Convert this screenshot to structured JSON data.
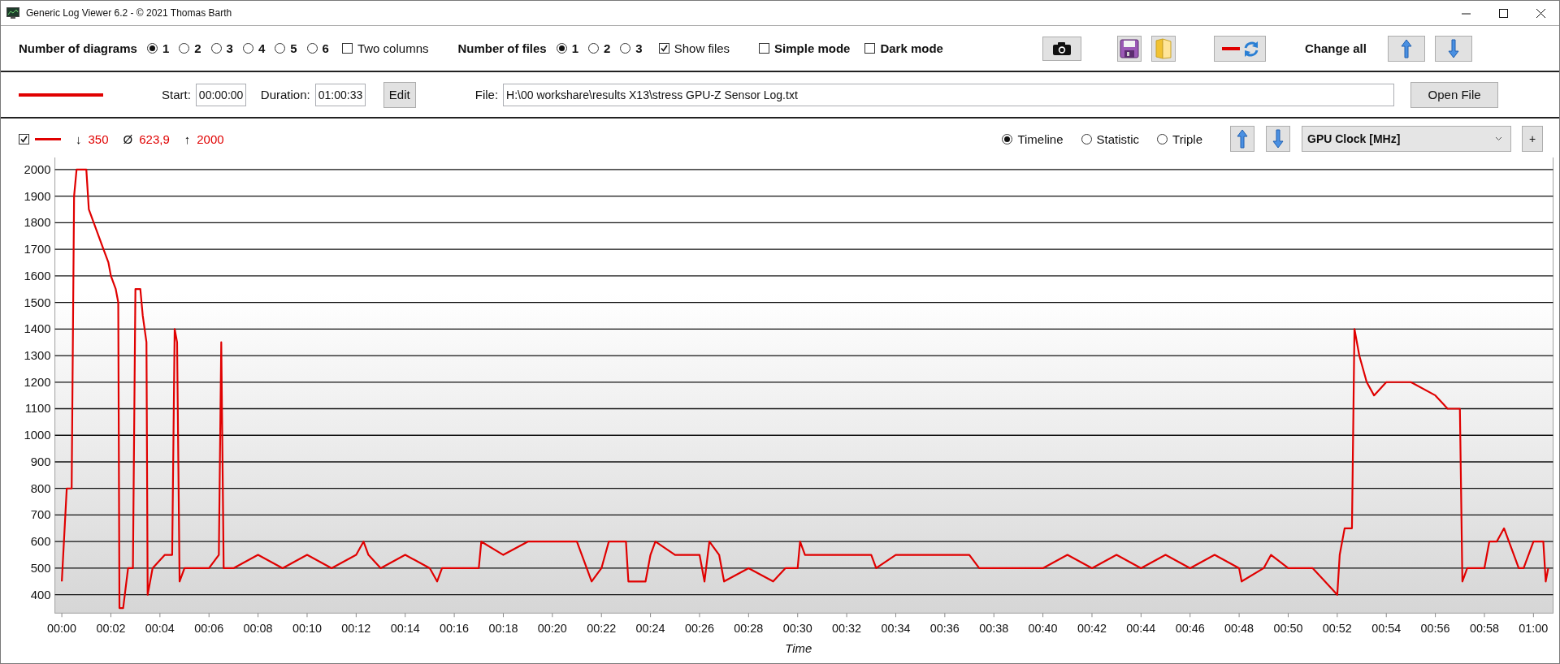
{
  "window": {
    "title": "Generic Log Viewer 6.2 - © 2021 Thomas Barth"
  },
  "toolbar": {
    "diagrams": {
      "label": "Number of diagrams",
      "options": [
        {
          "label": "1",
          "selected": true
        },
        {
          "label": "2",
          "selected": false
        },
        {
          "label": "3",
          "selected": false
        },
        {
          "label": "4",
          "selected": false
        },
        {
          "label": "5",
          "selected": false
        },
        {
          "label": "6",
          "selected": false
        }
      ]
    },
    "two_columns": {
      "label": "Two columns",
      "checked": false
    },
    "files": {
      "label": "Number of files",
      "options": [
        {
          "label": "1",
          "selected": true
        },
        {
          "label": "2",
          "selected": false
        },
        {
          "label": "3",
          "selected": false
        }
      ]
    },
    "show_files": {
      "label": "Show files",
      "checked": true
    },
    "simple_mode": {
      "label": "Simple mode",
      "checked": false
    },
    "dark_mode": {
      "label": "Dark mode",
      "checked": false
    },
    "change_all": {
      "label": "Change all"
    }
  },
  "file_row": {
    "start": {
      "label": "Start:",
      "value": "00:00:00"
    },
    "duration": {
      "label": "Duration:",
      "value": "01:00:33"
    },
    "edit_button": "Edit",
    "file": {
      "label": "File:",
      "value": "H:\\00 workshare\\results X13\\stress GPU-Z Sensor Log.txt"
    },
    "open_button": "Open File"
  },
  "diagram": {
    "visible": {
      "checked": true
    },
    "stats": [
      {
        "symbol": "↓",
        "value": "350"
      },
      {
        "symbol": "Ø",
        "value": "623,9"
      },
      {
        "symbol": "↑",
        "value": "2000"
      }
    ],
    "views": [
      {
        "label": "Timeline",
        "selected": true
      },
      {
        "label": "Statistic",
        "selected": false
      },
      {
        "label": "Triple",
        "selected": false
      }
    ],
    "sensor": {
      "value": "GPU Clock [MHz]"
    },
    "add_button": "+",
    "chart_data": {
      "type": "line",
      "grid": true,
      "xlabel": "Time",
      "x": [
        0,
        0.2,
        0.4,
        0.5,
        0.6,
        1.0,
        1.1,
        1.3,
        1.5,
        1.7,
        1.9,
        2.0,
        2.2,
        2.3,
        2.35,
        2.5,
        2.7,
        2.9,
        3.0,
        3.2,
        3.3,
        3.45,
        3.5,
        3.7,
        4.2,
        4.5,
        4.6,
        4.7,
        4.8,
        5.0,
        6.0,
        6.4,
        6.5,
        6.6,
        7,
        8,
        9,
        10,
        11,
        12,
        12.3,
        12.5,
        13,
        14,
        15,
        15.3,
        15.5,
        17,
        17.1,
        18,
        19,
        20,
        21,
        21.4,
        21.6,
        22,
        22.3,
        23,
        23.1,
        23.8,
        24,
        24.2,
        25,
        26,
        26.2,
        26.4,
        26.8,
        27,
        28,
        29,
        29.5,
        30,
        30.1,
        30.3,
        31,
        32,
        33,
        33.2,
        34,
        35,
        36,
        37,
        37.4,
        38,
        40,
        41,
        42,
        43,
        44,
        45,
        46,
        47,
        48,
        48.1,
        49,
        49.3,
        50,
        51,
        51.5,
        52,
        52.1,
        52.3,
        52.6,
        52.7,
        52.9,
        53.2,
        53.5,
        54,
        55,
        56,
        56.5,
        57,
        57.1,
        57.3,
        58,
        58.2,
        58.5,
        58.8,
        59.2,
        59.4,
        59.6,
        60.0,
        60.4,
        60.5,
        60.6
      ],
      "series": [
        {
          "color": "#e00000",
          "values": [
            450,
            800,
            800,
            1900,
            2000,
            2000,
            1850,
            1800,
            1750,
            1700,
            1650,
            1600,
            1550,
            1500,
            350,
            350,
            500,
            500,
            1550,
            1550,
            1450,
            1350,
            400,
            500,
            550,
            550,
            1400,
            1350,
            450,
            500,
            500,
            550,
            1350,
            500,
            500,
            550,
            500,
            550,
            500,
            550,
            600,
            550,
            500,
            550,
            500,
            450,
            500,
            500,
            600,
            550,
            600,
            600,
            600,
            500,
            450,
            500,
            600,
            600,
            450,
            450,
            550,
            600,
            550,
            550,
            450,
            600,
            550,
            450,
            500,
            450,
            500,
            500,
            600,
            550,
            550,
            550,
            550,
            500,
            550,
            550,
            550,
            550,
            500,
            500,
            500,
            550,
            500,
            550,
            500,
            550,
            500,
            550,
            500,
            450,
            500,
            550,
            500,
            500,
            450,
            400,
            550,
            650,
            650,
            1400,
            1300,
            1200,
            1150,
            1200,
            1200,
            1150,
            1100,
            1100,
            450,
            500,
            500,
            600,
            600,
            650,
            550,
            500,
            500,
            600,
            600,
            450,
            500
          ]
        }
      ],
      "xlim": [
        -0.15,
        60.8
      ],
      "ylim": [
        340,
        2050
      ],
      "xticks": [
        {
          "value": 0,
          "label": "00:00"
        },
        {
          "value": 2,
          "label": "00:02"
        },
        {
          "value": 4,
          "label": "00:04"
        },
        {
          "value": 6,
          "label": "00:06"
        },
        {
          "value": 8,
          "label": "00:08"
        },
        {
          "value": 10,
          "label": "00:10"
        },
        {
          "value": 12,
          "label": "00:12"
        },
        {
          "value": 14,
          "label": "00:14"
        },
        {
          "value": 16,
          "label": "00:16"
        },
        {
          "value": 18,
          "label": "00:18"
        },
        {
          "value": 20,
          "label": "00:20"
        },
        {
          "value": 22,
          "label": "00:22"
        },
        {
          "value": 24,
          "label": "00:24"
        },
        {
          "value": 26,
          "label": "00:26"
        },
        {
          "value": 28,
          "label": "00:28"
        },
        {
          "value": 30,
          "label": "00:30"
        },
        {
          "value": 32,
          "label": "00:32"
        },
        {
          "value": 34,
          "label": "00:34"
        },
        {
          "value": 36,
          "label": "00:36"
        },
        {
          "value": 38,
          "label": "00:38"
        },
        {
          "value": 40,
          "label": "00:40"
        },
        {
          "value": 42,
          "label": "00:42"
        },
        {
          "value": 44,
          "label": "00:44"
        },
        {
          "value": 46,
          "label": "00:46"
        },
        {
          "value": 48,
          "label": "00:48"
        },
        {
          "value": 50,
          "label": "00:50"
        },
        {
          "value": 52,
          "label": "00:52"
        },
        {
          "value": 54,
          "label": "00:54"
        },
        {
          "value": 56,
          "label": "00:56"
        },
        {
          "value": 58,
          "label": "00:58"
        },
        {
          "value": 60,
          "label": "01:00"
        }
      ],
      "yticks": [
        400,
        500,
        600,
        700,
        800,
        900,
        1000,
        1100,
        1200,
        1300,
        1400,
        1500,
        1600,
        1700,
        1800,
        1900,
        2000
      ]
    }
  }
}
